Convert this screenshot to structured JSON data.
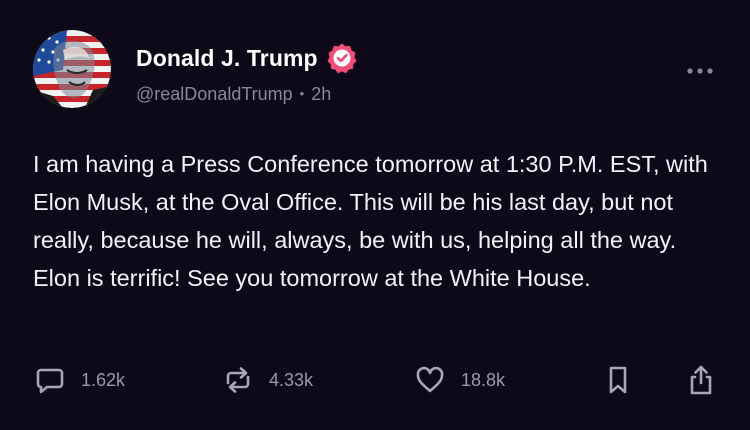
{
  "author": {
    "display_name": "Donald J. Trump",
    "handle": "@realDonaldTrump",
    "separator": "•",
    "timestamp": "2h",
    "verified": true,
    "verified_color": "#ef4d78"
  },
  "post": {
    "text": "I am having a Press Conference tomorrow at 1:30 P.M. EST, with Elon Musk, at the Oval Office. This will be his last day, but not really, because he will, always, be with us, helping all the way. Elon is terrific! See you tomorrow at the White House."
  },
  "actions": {
    "reply": {
      "icon": "reply-icon",
      "count": "1.62k"
    },
    "retruth": {
      "icon": "retruth-icon",
      "count": "4.33k"
    },
    "like": {
      "icon": "heart-icon",
      "count": "18.8k"
    },
    "bookmark": {
      "icon": "bookmark-icon"
    },
    "share": {
      "icon": "share-icon"
    }
  },
  "colors": {
    "background": "#0d0918",
    "text": "#f3f2f6",
    "muted": "#8a8796"
  }
}
